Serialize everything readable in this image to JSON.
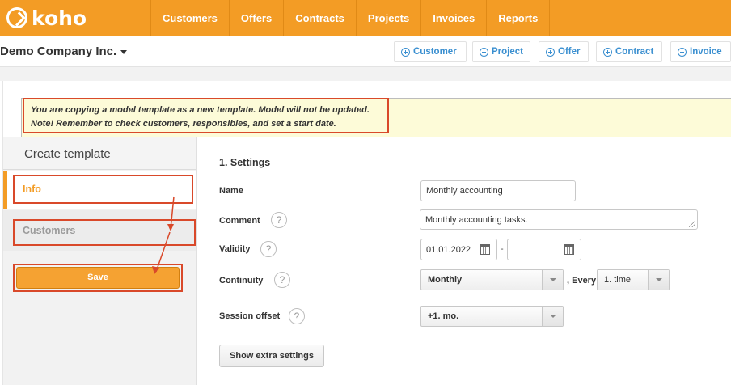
{
  "brand": {
    "name": "koho",
    "accent": "#f39c25",
    "alert": "#d9492a"
  },
  "nav": {
    "items": [
      "Customers",
      "Offers",
      "Contracts",
      "Projects",
      "Invoices",
      "Reports"
    ]
  },
  "company": {
    "name": "Demo Company Inc."
  },
  "quick_actions": [
    "Customer",
    "Project",
    "Offer",
    "Contract",
    "Invoice"
  ],
  "notice": {
    "line1": "You are copying a model template as a new template. Model will not be updated.",
    "line2": "Note! Remember to check customers, responsibles, and set a start date."
  },
  "sidebar": {
    "title": "Create template",
    "items": [
      {
        "label": "Info",
        "active": true
      },
      {
        "label": "Customers",
        "active": false
      }
    ],
    "save_label": "Save"
  },
  "form": {
    "section_title": "1. Settings",
    "name": {
      "label": "Name",
      "value": "Monthly accounting"
    },
    "comment": {
      "label": "Comment",
      "help": "?",
      "value": "Monthly accounting tasks."
    },
    "validity": {
      "label": "Validity",
      "help": "?",
      "start": "01.01.2022",
      "separator": "-",
      "end": ""
    },
    "continuity": {
      "label": "Continuity",
      "help": "?",
      "value": "Monthly",
      "every_label": ", Every",
      "every_value": "1. time"
    },
    "session_offset": {
      "label": "Session offset",
      "help": "?",
      "value": "+1. mo."
    },
    "extra_label": "Show extra settings"
  }
}
